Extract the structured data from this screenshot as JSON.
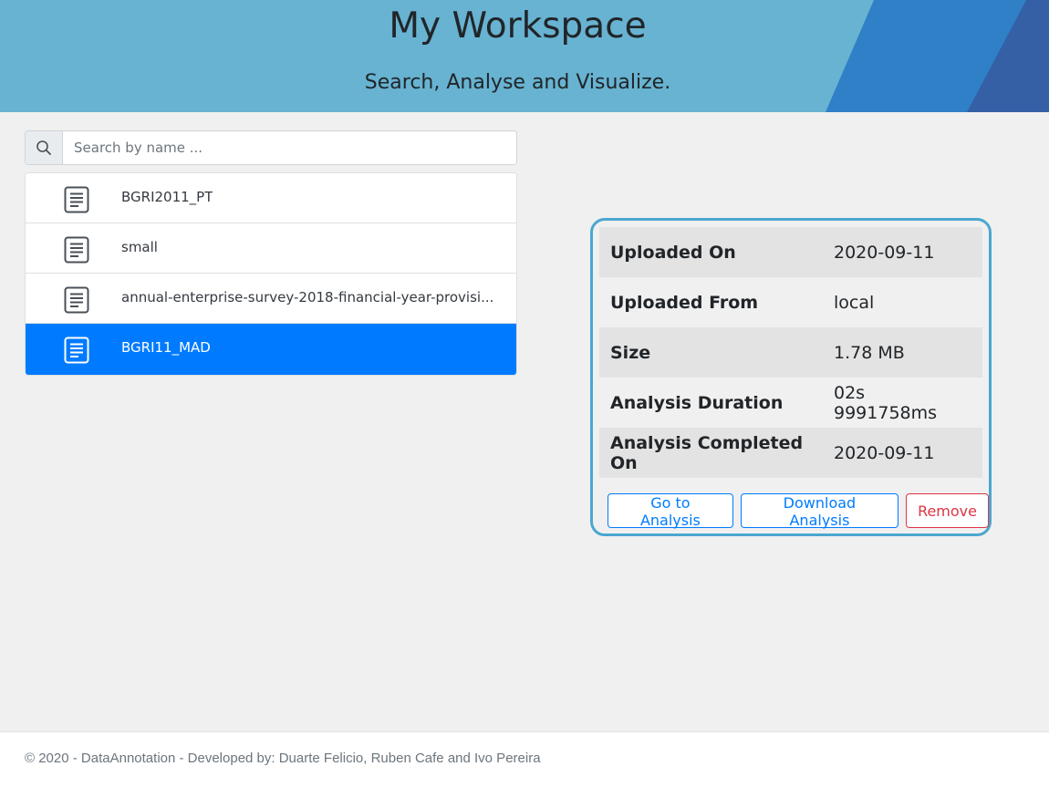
{
  "header": {
    "title": "My Workspace",
    "subtitle": "Search, Analyse and Visualize."
  },
  "search": {
    "placeholder": "Search by name ...",
    "value": ""
  },
  "files": [
    {
      "name": "BGRI2011_PT",
      "active": false
    },
    {
      "name": "small",
      "active": false
    },
    {
      "name": "annual-enterprise-survey-2018-financial-year-provisi...",
      "active": false
    },
    {
      "name": "BGRI11_MAD",
      "active": true
    }
  ],
  "details": {
    "rows": [
      {
        "label": "Uploaded On",
        "value": "2020-09-11"
      },
      {
        "label": "Uploaded From",
        "value": "local"
      },
      {
        "label": "Size",
        "value": "1.78 MB"
      },
      {
        "label": "Analysis Duration",
        "value": "02s 9991758ms"
      },
      {
        "label": "Analysis Completed On",
        "value": "2020-09-11"
      }
    ],
    "buttons": {
      "go": "Go to Analysis",
      "download": "Download Analysis",
      "remove": "Remove"
    }
  },
  "footer": {
    "text": "© 2020 - DataAnnotation - Developed by: Duarte Felicio, Ruben Cafe and Ivo Pereira"
  },
  "colors": {
    "banner": "#67b3d1",
    "active": "#007bff",
    "card_border": "#4aa7cf",
    "danger": "#dc3545"
  },
  "icons": {
    "search": "search-icon",
    "file": "file-text-icon"
  }
}
